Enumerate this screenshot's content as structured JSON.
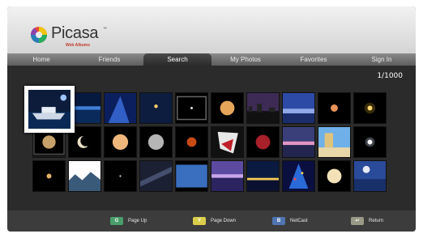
{
  "app": {
    "name": "Picasa",
    "tm": "™",
    "subtitle": "Web Albums"
  },
  "nav": {
    "items": [
      "Home",
      "Friends",
      "Search",
      "My Photos",
      "Favorites",
      "Sign In"
    ],
    "active_index": 2
  },
  "pager": {
    "label": "1/1000"
  },
  "photos": [
    {
      "row": 0,
      "col": 0,
      "theme": "yacht-night",
      "selected": true
    },
    {
      "row": 0,
      "col": 1,
      "theme": "blue-horizon"
    },
    {
      "row": 0,
      "col": 2,
      "theme": "blue-glow"
    },
    {
      "row": 0,
      "col": 3,
      "theme": "night-blue-moon"
    },
    {
      "row": 0,
      "col": 4,
      "theme": "dark-dot-framed"
    },
    {
      "row": 0,
      "col": 5,
      "theme": "full-moon-orange"
    },
    {
      "row": 0,
      "col": 6,
      "theme": "cityscape-dusk"
    },
    {
      "row": 0,
      "col": 7,
      "theme": "blue-sky-clouds"
    },
    {
      "row": 0,
      "col": 8,
      "theme": "small-moon-orange"
    },
    {
      "row": 0,
      "col": 9,
      "theme": "glowing-moon"
    },
    {
      "row": 1,
      "col": 0,
      "theme": "moon-eclipse-framed"
    },
    {
      "row": 1,
      "col": 1,
      "theme": "crescent-moon"
    },
    {
      "row": 1,
      "col": 2,
      "theme": "full-moon-peach"
    },
    {
      "row": 1,
      "col": 3,
      "theme": "full-moon-grey"
    },
    {
      "row": 1,
      "col": 4,
      "theme": "red-moon"
    },
    {
      "row": 1,
      "col": 5,
      "theme": "abstract-red"
    },
    {
      "row": 1,
      "col": 6,
      "theme": "blood-moon"
    },
    {
      "row": 1,
      "col": 7,
      "theme": "pink-horizon"
    },
    {
      "row": 1,
      "col": 8,
      "theme": "beach-huts"
    },
    {
      "row": 1,
      "col": 9,
      "theme": "bright-star"
    },
    {
      "row": 2,
      "col": 0,
      "theme": "tiny-moon"
    },
    {
      "row": 2,
      "col": 1,
      "theme": "mountain-landscape"
    },
    {
      "row": 2,
      "col": 2,
      "theme": "dark-sky-dot"
    },
    {
      "row": 2,
      "col": 3,
      "theme": "milky-way"
    },
    {
      "row": 2,
      "col": 4,
      "theme": "blue-panel"
    },
    {
      "row": 2,
      "col": 5,
      "theme": "purple-sunset"
    },
    {
      "row": 2,
      "col": 6,
      "theme": "city-lights"
    },
    {
      "row": 2,
      "col": 7,
      "theme": "christmas-lights"
    },
    {
      "row": 2,
      "col": 8,
      "theme": "moon-cream"
    },
    {
      "row": 2,
      "col": 9,
      "theme": "moon-blue-sky"
    }
  ],
  "footer": {
    "hints": [
      {
        "key": "G",
        "label": "Page Up",
        "color": "#4a9e6b"
      },
      {
        "key": "Y",
        "label": "Page Down",
        "color": "#d9cd4a"
      },
      {
        "key": "B",
        "label": "NetCast",
        "color": "#4f74b0"
      },
      {
        "key": "↩",
        "label": "Return",
        "color": "#9a9a88"
      }
    ]
  }
}
